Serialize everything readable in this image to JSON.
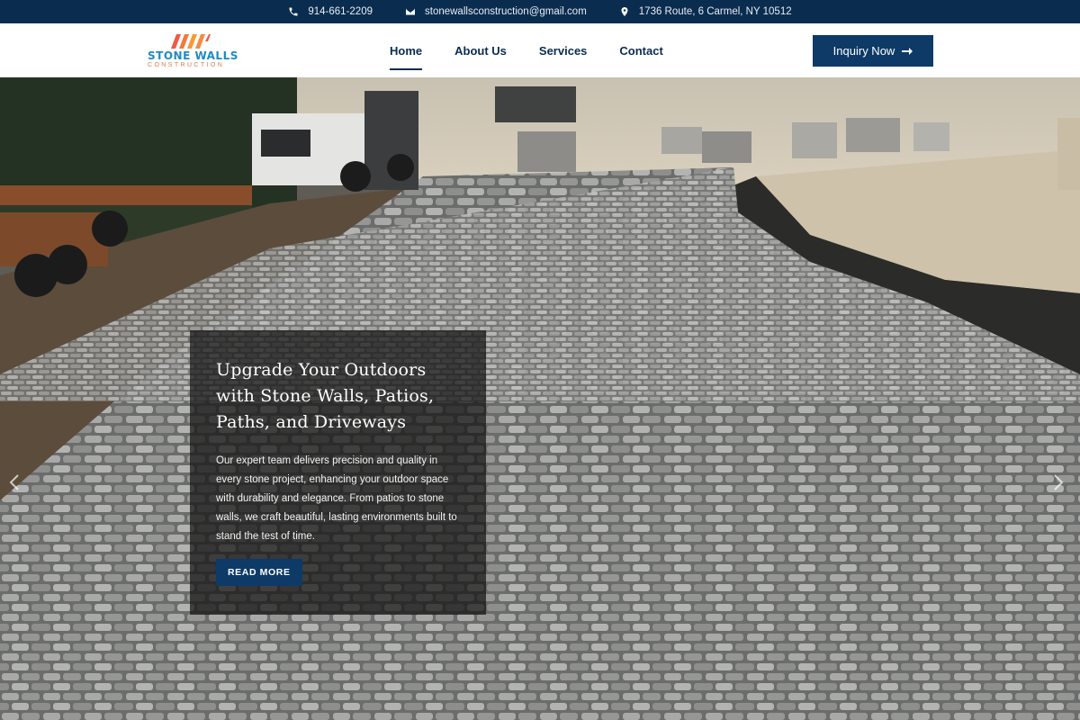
{
  "topbar": {
    "phone": "914-661-2209",
    "email": "stonewallsconstruction@gmail.com",
    "address": "1736 Route, 6 Carmel, NY 10512"
  },
  "logo": {
    "name": "STONE WALLS",
    "sub": "CONSTRUCTION"
  },
  "nav": {
    "items": [
      {
        "label": "Home",
        "active": true
      },
      {
        "label": "About Us"
      },
      {
        "label": "Services"
      },
      {
        "label": "Contact"
      }
    ],
    "cta_label": "Inquiry Now"
  },
  "hero": {
    "title": "Upgrade Your Outdoors with Stone Walls, Patios, Paths, and Driveways",
    "text": "Our expert team delivers precision and quality in every stone project, enhancing your outdoor space with durability and elegance. From patios to stone walls, we craft beautiful, lasting environments built to stand the test of time.",
    "button_label": "READ MORE"
  },
  "icons": {
    "phone": "phone-icon",
    "email": "envelope-icon",
    "address": "map-pin-icon",
    "cta": "arrow-right-icon",
    "prev": "chevron-left-icon",
    "next": "chevron-right-icon"
  },
  "colors": {
    "navy": "#0a2c4f",
    "button": "#0d3a66",
    "logo_blue": "#1f8bc2",
    "logo_orange": "#e07a45"
  }
}
